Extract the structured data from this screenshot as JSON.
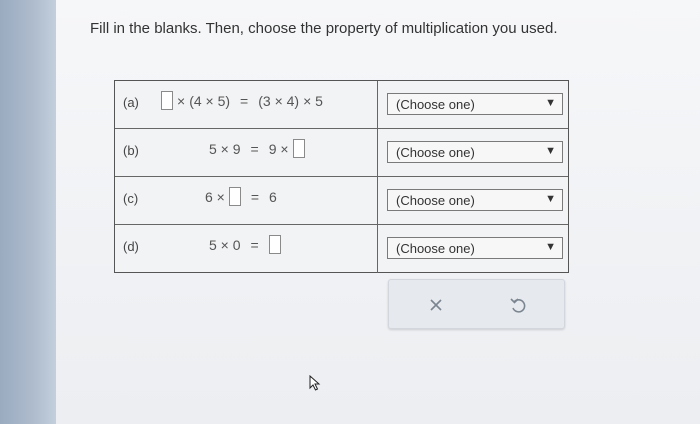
{
  "instructions": "Fill in the blanks. Then, choose the property of multiplication you used.",
  "rows": [
    {
      "label": "(a)",
      "expr": {
        "p1": "×",
        "p2": "(4 × 5)",
        "p3": "=",
        "p4": "(3 × 4)",
        "p5": "× 5"
      },
      "select": "(Choose one)"
    },
    {
      "label": "(b)",
      "expr": {
        "p1": "5 × 9",
        "p2": "=",
        "p3": "9 ×"
      },
      "select": "(Choose one)"
    },
    {
      "label": "(c)",
      "expr": {
        "p1": "6 ×",
        "p2": "=",
        "p3": "6"
      },
      "select": "(Choose one)"
    },
    {
      "label": "(d)",
      "expr": {
        "p1": "5 × 0",
        "p2": "="
      },
      "select": "(Choose one)"
    }
  ],
  "icons": {
    "dropdown": "chevron-down-icon",
    "clear": "close-icon",
    "undo": "undo-icon",
    "cursor": "mouse-pointer-icon"
  },
  "colors": {
    "action_icon": "#7b8590",
    "panel_bg": "#e6e9ee"
  }
}
